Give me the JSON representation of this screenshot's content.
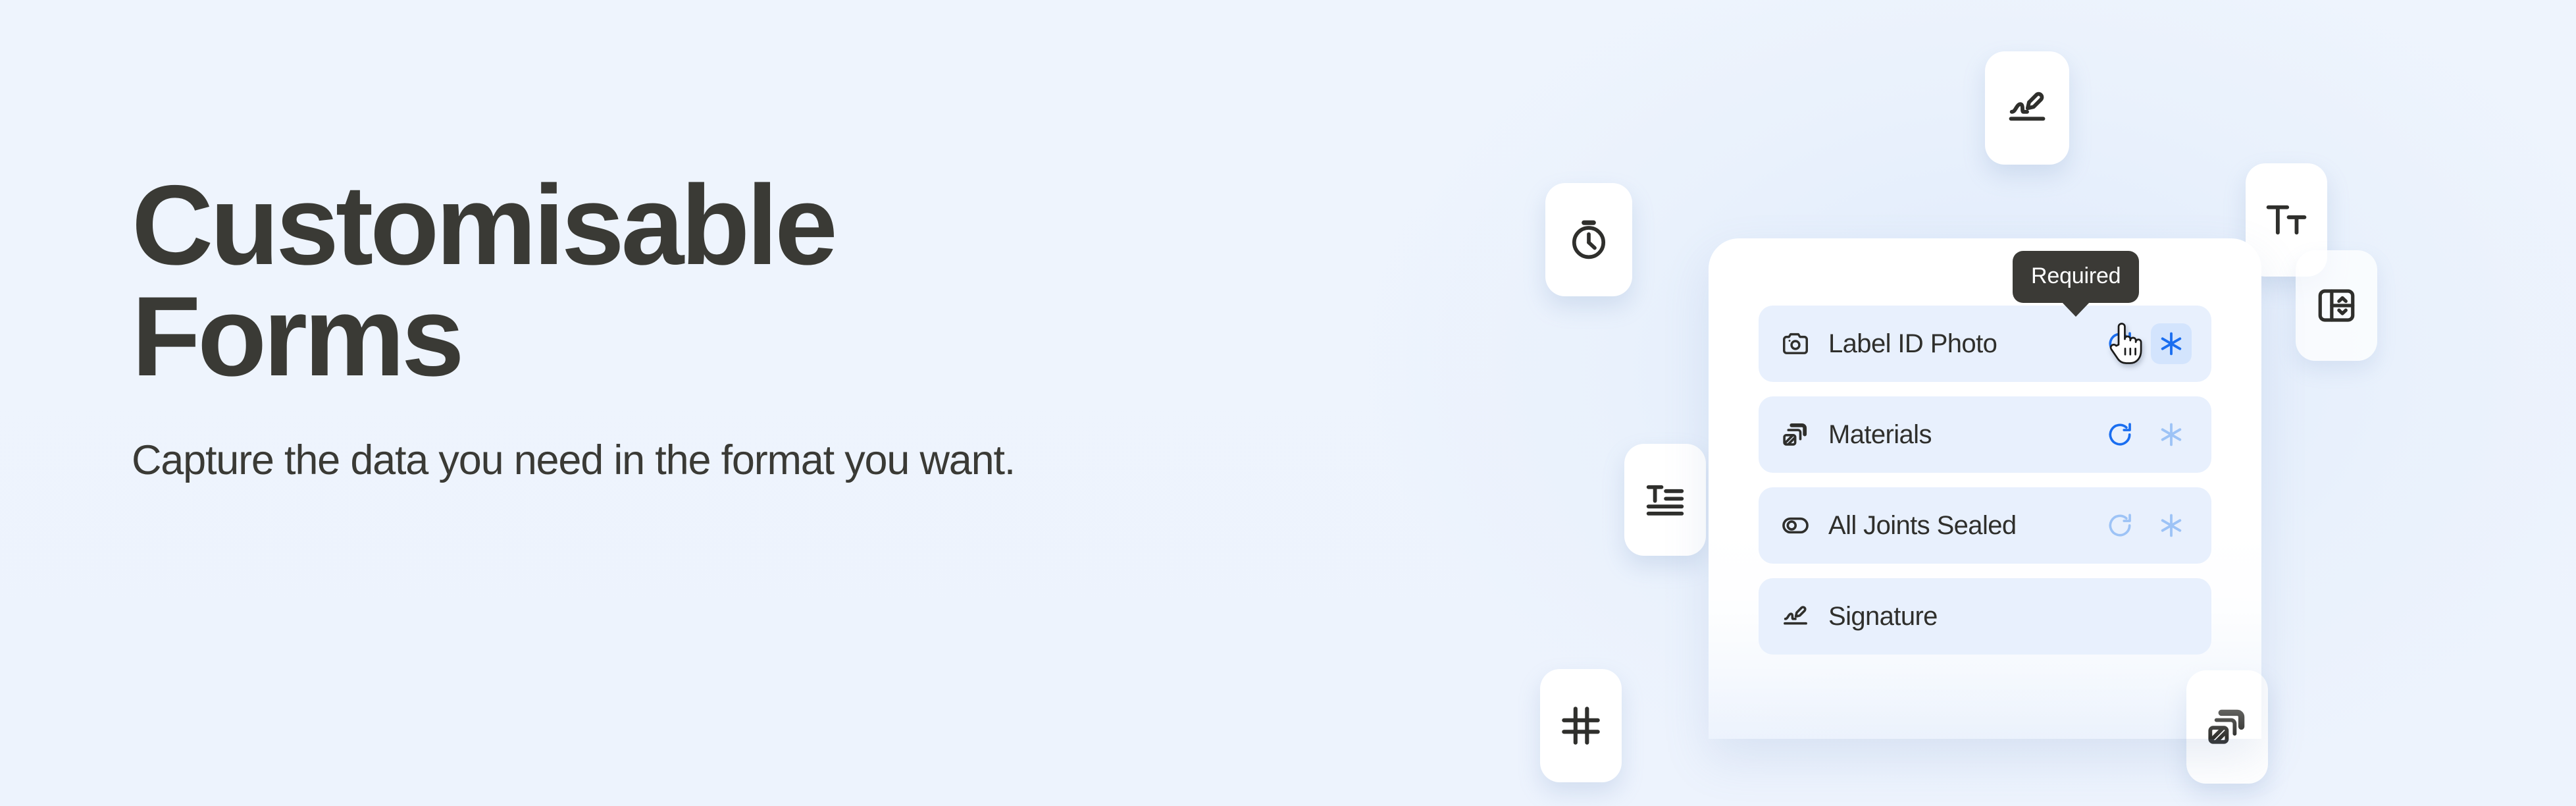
{
  "hero": {
    "headline": "Customisable\nForms",
    "subhead": "Capture the data you need in the format you want."
  },
  "colors": {
    "page_background": "#eef4fd",
    "headline_text": "#3a3a35",
    "card_background": "#ffffff",
    "row_background": "#e8f0fd",
    "accent_blue": "#1a6ef0",
    "accent_blue_faded": "#9dc3f6",
    "highlight_chip": "#d3e4fd",
    "tooltip_background": "#3b3a36",
    "tooltip_text": "#ffffff"
  },
  "form": {
    "tooltip": {
      "label": "Required"
    },
    "rows": [
      {
        "label": "Label ID Photo",
        "lead_icon": "camera-icon",
        "repeat_icon": "repeat-icon",
        "repeat_state": "active",
        "required_icon": "asterisk-icon",
        "required_state": "active",
        "highlighted": true
      },
      {
        "label": "Materials",
        "lead_icon": "multi-select-icon",
        "repeat_icon": "repeat-icon",
        "repeat_state": "active",
        "required_icon": "asterisk-icon",
        "required_state": "inactive",
        "highlighted": false
      },
      {
        "label": "All Joints Sealed",
        "lead_icon": "toggle-icon",
        "repeat_icon": "repeat-icon",
        "repeat_state": "inactive",
        "required_icon": "asterisk-icon",
        "required_state": "inactive",
        "highlighted": false
      },
      {
        "label": "Signature",
        "lead_icon": "signature-icon",
        "repeat_icon": null,
        "repeat_state": null,
        "required_icon": null,
        "required_state": null,
        "highlighted": false
      }
    ]
  },
  "floating_badges": [
    {
      "name": "signature-icon",
      "tooltip": "Signature"
    },
    {
      "name": "stopwatch-icon",
      "tooltip": "Timer"
    },
    {
      "name": "text-size-icon",
      "tooltip": "Text size"
    },
    {
      "name": "stepper-icon",
      "tooltip": "Stepper"
    },
    {
      "name": "text-paragraph-icon",
      "tooltip": "Paragraph"
    },
    {
      "name": "number-icon",
      "tooltip": "Number"
    },
    {
      "name": "multi-select-icon",
      "tooltip": "Multi select"
    }
  ],
  "cursor": {
    "icon": "pointing-hand-cursor"
  }
}
